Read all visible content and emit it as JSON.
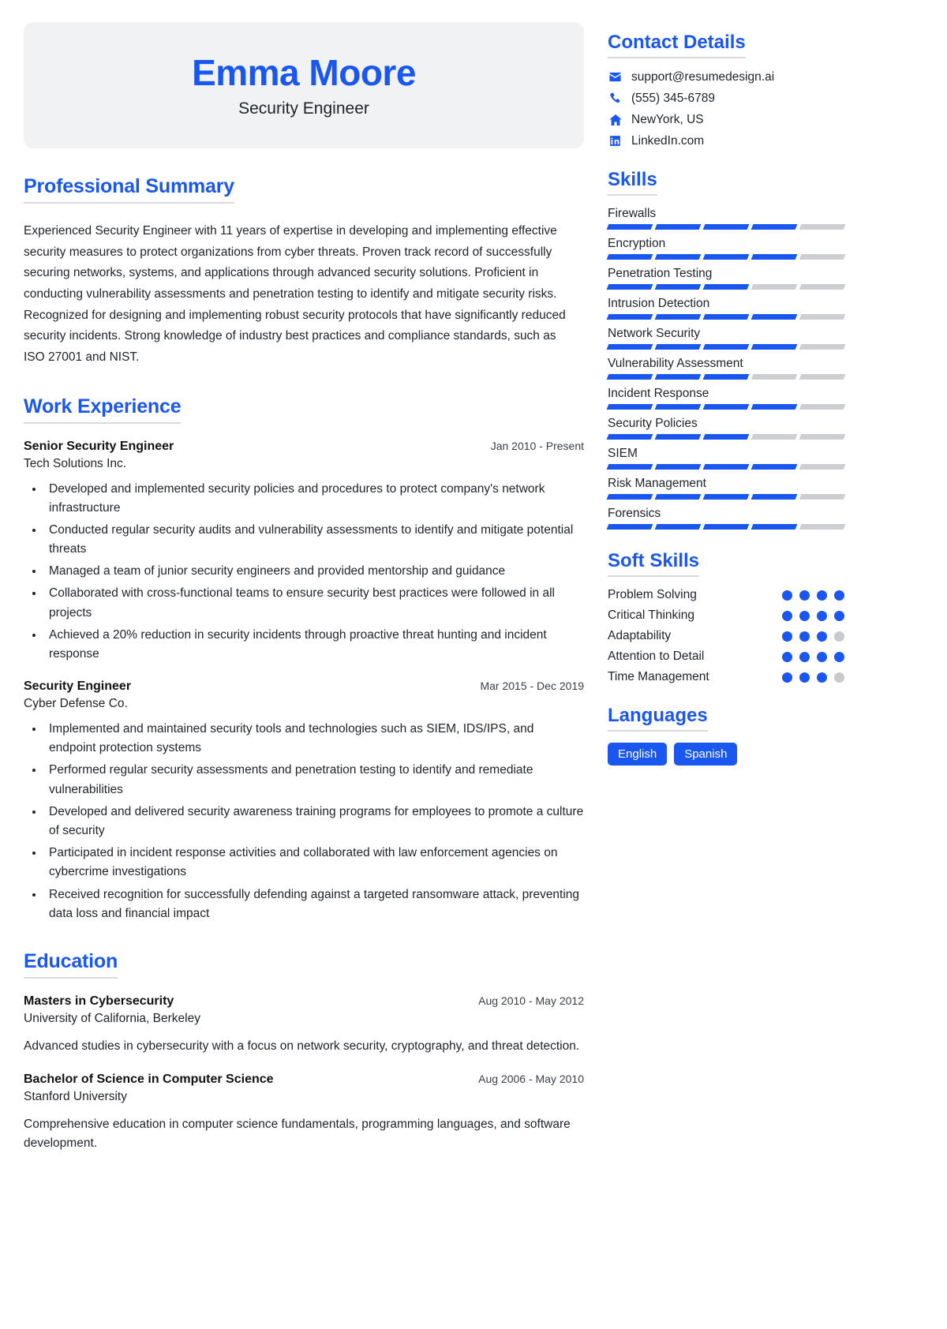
{
  "header": {
    "name": "Emma Moore",
    "role": "Security Engineer"
  },
  "colors": {
    "accent": "#1a56f0",
    "banner_bg": "#f1f2f4",
    "bar_off": "#cdced2",
    "text": "#20252b"
  },
  "summary": {
    "title": "Professional Summary",
    "text": "Experienced Security Engineer with 11 years of expertise in developing and implementing effective security measures to protect organizations from cyber threats. Proven track record of successfully securing networks, systems, and applications through advanced security solutions. Proficient in conducting vulnerability assessments and penetration testing to identify and mitigate security risks. Recognized for designing and implementing robust security protocols that have significantly reduced security incidents. Strong knowledge of industry best practices and compliance standards, such as ISO 27001 and NIST."
  },
  "work": {
    "title": "Work Experience",
    "entries": [
      {
        "title": "Senior Security Engineer",
        "date": "Jan 2010 - Present",
        "org": "Tech Solutions Inc.",
        "bullets": [
          "Developed and implemented security policies and procedures to protect company's network infrastructure",
          "Conducted regular security audits and vulnerability assessments to identify and mitigate potential threats",
          "Managed a team of junior security engineers and provided mentorship and guidance",
          "Collaborated with cross-functional teams to ensure security best practices were followed in all projects",
          "Achieved a 20% reduction in security incidents through proactive threat hunting and incident response"
        ]
      },
      {
        "title": "Security Engineer",
        "date": "Mar 2015 - Dec 2019",
        "org": "Cyber Defense Co.",
        "bullets": [
          "Implemented and maintained security tools and technologies such as SIEM, IDS/IPS, and endpoint protection systems",
          "Performed regular security assessments and penetration testing to identify and remediate vulnerabilities",
          "Developed and delivered security awareness training programs for employees to promote a culture of security",
          "Participated in incident response activities and collaborated with law enforcement agencies on cybercrime investigations",
          "Received recognition for successfully defending against a targeted ransomware attack, preventing data loss and financial impact"
        ]
      }
    ]
  },
  "education": {
    "title": "Education",
    "entries": [
      {
        "title": "Masters in Cybersecurity",
        "date": "Aug 2010 - May 2012",
        "org": "University of California, Berkeley",
        "desc": "Advanced studies in cybersecurity with a focus on network security, cryptography, and threat detection."
      },
      {
        "title": "Bachelor of Science in Computer Science",
        "date": "Aug 2006 - May 2010",
        "org": "Stanford University",
        "desc": "Comprehensive education in computer science fundamentals, programming languages, and software development."
      }
    ]
  },
  "contact": {
    "title": "Contact Details",
    "items": [
      {
        "icon": "envelope-icon",
        "value": "support@resumedesign.ai"
      },
      {
        "icon": "phone-icon",
        "value": "(555) 345-6789"
      },
      {
        "icon": "home-icon",
        "value": "NewYork, US"
      },
      {
        "icon": "linkedin-icon",
        "value": "LinkedIn.com"
      }
    ]
  },
  "skills": {
    "title": "Skills",
    "segments_total": 5,
    "items": [
      {
        "name": "Firewalls",
        "filled": 4
      },
      {
        "name": "Encryption",
        "filled": 4
      },
      {
        "name": "Penetration Testing",
        "filled": 3
      },
      {
        "name": "Intrusion Detection",
        "filled": 4
      },
      {
        "name": "Network Security",
        "filled": 4
      },
      {
        "name": "Vulnerability Assessment",
        "filled": 3
      },
      {
        "name": "Incident Response",
        "filled": 4
      },
      {
        "name": "Security Policies",
        "filled": 3
      },
      {
        "name": "SIEM",
        "filled": 4
      },
      {
        "name": "Risk Management",
        "filled": 4
      },
      {
        "name": "Forensics",
        "filled": 4
      }
    ]
  },
  "soft_skills": {
    "title": "Soft Skills",
    "dots_total": 4,
    "items": [
      {
        "name": "Problem Solving",
        "filled": 4
      },
      {
        "name": "Critical Thinking",
        "filled": 4
      },
      {
        "name": "Adaptability",
        "filled": 3
      },
      {
        "name": "Attention to Detail",
        "filled": 4
      },
      {
        "name": "Time Management",
        "filled": 3
      }
    ]
  },
  "languages": {
    "title": "Languages",
    "items": [
      "English",
      "Spanish"
    ]
  }
}
